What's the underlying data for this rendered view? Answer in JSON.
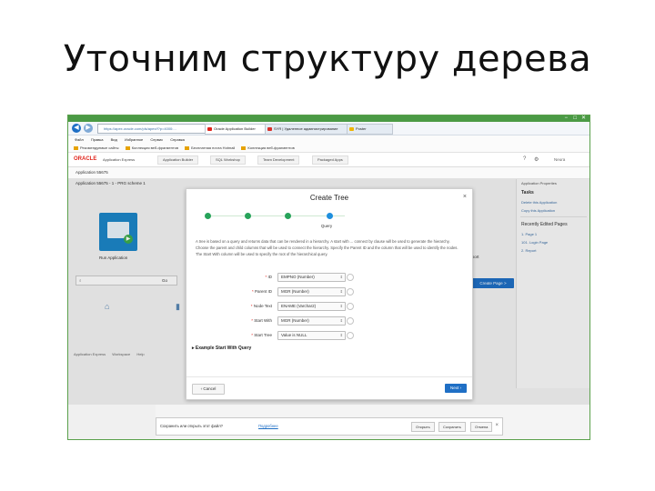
{
  "slide": {
    "title": "Уточним структуру дерева"
  },
  "browser": {
    "window_controls": [
      "−",
      "□",
      "✕"
    ],
    "address": "https://apex.oracle.com/pls/apex/f?p=4000:...",
    "tabs": [
      {
        "label": "Oracle Application Builder",
        "color": "#e0241b",
        "active": true
      },
      {
        "label": "SYR | Удаленное администрирование",
        "color": "#d9302a",
        "active": false
      },
      {
        "label": "Poster",
        "color": "#f0b400",
        "active": false
      }
    ],
    "menu": [
      "Файл",
      "Правка",
      "Вид",
      "Избранное",
      "Сервис",
      "Справка"
    ],
    "favorites": [
      "Рекомендуемые сайты",
      "Коллекция веб-фрагментов",
      "Бесплатная почта Hotmail",
      "Коллекция веб-фрагментов"
    ]
  },
  "apex": {
    "brand": "ORACLE",
    "product": "Application Express",
    "nav": [
      "Application Builder",
      "SQL Workshop",
      "Team Development",
      "Packaged Apps"
    ],
    "user": "Neura",
    "breadcrumb": "Application 55675",
    "subheader": "Application 55675 - 1 - PRG scheme 1",
    "run_application": "Run Application",
    "search_go": "Go",
    "create_page": "Create Page >",
    "report_label": "Report",
    "bottom_links": [
      "Application Express",
      "Workspace",
      "Help"
    ],
    "properties": "Application Properties"
  },
  "right_panel": {
    "tasks_title": "Tasks",
    "tasks": [
      "Delete this Application",
      "Copy this Application"
    ],
    "recent_title": "Recently Edited Pages",
    "recent": [
      "1. Page 1",
      "101. Login Page",
      "2. Report"
    ]
  },
  "dialog": {
    "title": "Create Tree",
    "close": "×",
    "step_label": "Query",
    "steps_total": 4,
    "current_step": 4,
    "description": "A tree is based on a query and returns data that can be rendered in a hierarchy. A start with ... connect by clause will be used to generate the hierarchy. Choose the parent and child columns that will be used to connect the hierarchy. Specify the Parent ID and the column that will be used to identify the nodes. The Start With column will be used to specify the root of the hierarchical query.",
    "fields": [
      {
        "label": "ID",
        "value": "EMPNO (Number)"
      },
      {
        "label": "Parent ID",
        "value": "MGR (Number)"
      },
      {
        "label": "Node Text",
        "value": "ENAME (Varchar2)"
      },
      {
        "label": "Start With",
        "value": "MGR (Number)"
      },
      {
        "label": "Start Tree",
        "value": "Value is NULL"
      }
    ],
    "example": "Example Start With Query",
    "cancel": "Cancel",
    "next": "Next"
  },
  "statusbar": {
    "text": "Сохранить или открыть этот файл?",
    "link": "Подробнее",
    "buttons": [
      "Открыть",
      "Сохранить",
      "Отмена"
    ]
  }
}
